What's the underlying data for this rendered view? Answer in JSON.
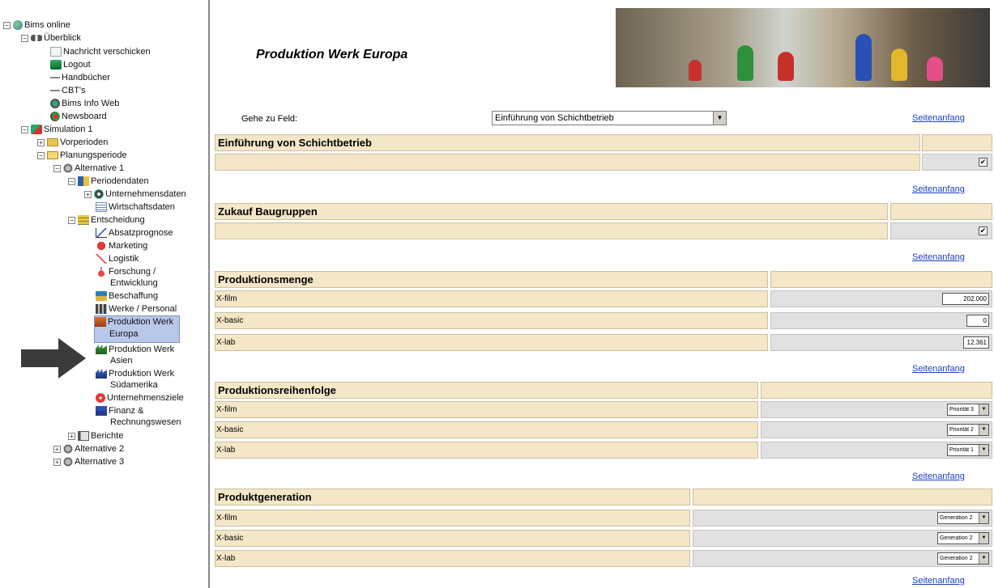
{
  "tree": {
    "root": "Bims online",
    "ueberblick": "Überblick",
    "nachricht": "Nachricht verschicken",
    "logout": "Logout",
    "handbuecher": "Handbücher",
    "cbts": "CBT's",
    "infoweb": "Bims Info Web",
    "newsboard": "Newsboard",
    "simulation": "Simulation 1",
    "vorperioden": "Vorperioden",
    "planungsperiode": "Planungsperiode",
    "alt1": "Alternative 1",
    "periodendaten": "Periodendaten",
    "unternehmensdaten": "Unternehmensdaten",
    "wirtschaftsdaten": "Wirtschaftsdaten",
    "entscheidung": "Entscheidung",
    "absatzprognose": "Absatzprognose",
    "marketing": "Marketing",
    "logistik": "Logistik",
    "forschung1": "Forschung /",
    "forschung2": "Entwicklung",
    "beschaffung": "Beschaffung",
    "werke": "Werke / Personal",
    "pwe1": "Produktion Werk",
    "pwe2": "Europa",
    "pwa1": "Produktion Werk",
    "pwa2": "Asien",
    "pws1": "Produktion Werk",
    "pws2": "Südamerika",
    "ziele": "Unternehmensziele",
    "finanz1": "Finanz &",
    "finanz2": "Rechnungswesen",
    "berichte": "Berichte",
    "alt2": "Alternative 2",
    "alt3": "Alternative 3"
  },
  "page": {
    "title": "Produktion Werk Europa",
    "goto_label": "Gehe zu Feld:",
    "goto_value": "Einführung von Schichtbetrieb",
    "top_link": "Seitenanfang"
  },
  "sections": {
    "schicht": {
      "title": "Einführung von Schichtbetrieb",
      "checked": "✔"
    },
    "zukauf": {
      "title": "Zukauf Baugruppen",
      "checked": "✔"
    },
    "menge": {
      "title": "Produktionsmenge",
      "rows": [
        {
          "label": "X-film",
          "value": "202.000"
        },
        {
          "label": "X-basic",
          "value": "0"
        },
        {
          "label": "X-lab",
          "value": "12.361"
        }
      ]
    },
    "reihenfolge": {
      "title": "Produktionsreihenfolge",
      "rows": [
        {
          "label": "X-film",
          "value": "Priorität 3"
        },
        {
          "label": "X-basic",
          "value": "Priorität 2"
        },
        {
          "label": "X-lab",
          "value": "Priorität 1"
        }
      ]
    },
    "generation": {
      "title": "Produktgeneration",
      "rows": [
        {
          "label": "X-film",
          "value": "Generation 2"
        },
        {
          "label": "X-basic",
          "value": "Generation 2"
        },
        {
          "label": "X-lab",
          "value": "Generation 2"
        }
      ]
    }
  }
}
